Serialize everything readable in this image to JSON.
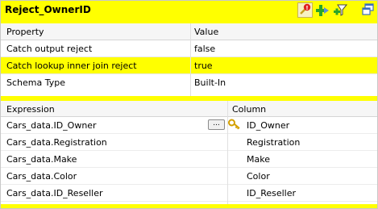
{
  "title": "Reject_OwnerID",
  "toolbar": {
    "filter_badge": "!",
    "icons": [
      "filter-reject-icon",
      "add-output-icon",
      "add-filter-icon",
      "expand-icon"
    ],
    "colors": {
      "highlight": "#ffff00",
      "badge": "#e02020",
      "plus": "#2aa52a"
    }
  },
  "properties": {
    "headers": {
      "property": "Property",
      "value": "Value"
    },
    "rows": [
      {
        "property": "Catch output reject",
        "value": "false"
      },
      {
        "property": "Catch lookup inner join reject",
        "value": "true"
      },
      {
        "property": "Schema Type",
        "value": "Built-In"
      }
    ]
  },
  "expressions": {
    "headers": {
      "expression": "Expression",
      "column": "Column"
    },
    "rows": [
      {
        "expression": "Cars_data.ID_Owner",
        "column": "ID_Owner",
        "button": "...",
        "key": true
      },
      {
        "expression": "Cars_data.Registration",
        "column": "Registration"
      },
      {
        "expression": "Cars_data.Make",
        "column": "Make"
      },
      {
        "expression": "Cars_data.Color",
        "column": "Color"
      },
      {
        "expression": "Cars_data.ID_Reseller",
        "column": "ID_Reseller"
      }
    ]
  }
}
